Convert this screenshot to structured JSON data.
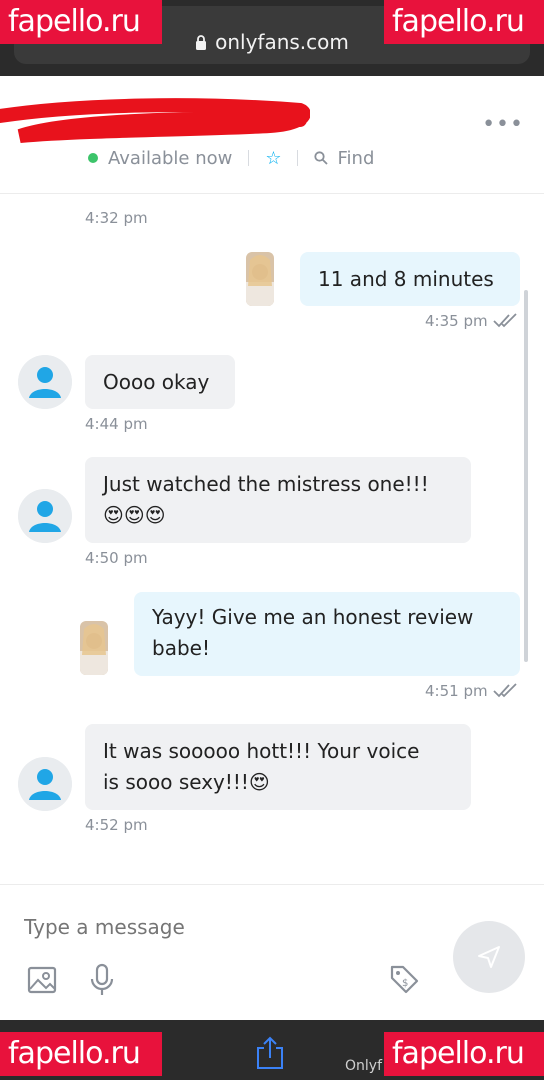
{
  "browser": {
    "url": "onlyfans.com",
    "watermark": "fapello.ru",
    "bottom_text": "Onlyf"
  },
  "header": {
    "status": "Available now",
    "find_label": "Find",
    "more_icon": "more-dots-icon",
    "star_icon": "star-icon",
    "search_icon": "search-icon"
  },
  "messages": {
    "t0": "4:32 pm",
    "m1_text": "11 and 8 minutes",
    "m1_time": "4:35 pm",
    "m2_text": "Oooo okay",
    "m2_time": "4:44 pm",
    "m3_line1": "Just watched the mistress one!!!",
    "m3_line2": "😍😍😍",
    "m3_time": "4:50 pm",
    "m4_line1": "Yayy! Give me an honest review",
    "m4_line2": "babe!",
    "m4_time": "4:51 pm",
    "m5_line1": "It was sooooo hott!!! Your voice",
    "m5_line2": "is sooo sexy!!!😍",
    "m5_time": "4:52 pm"
  },
  "composer": {
    "placeholder": "Type a message",
    "icons": [
      "image-icon",
      "microphone-icon",
      "price-tag-icon",
      "send-icon"
    ]
  },
  "colors": {
    "accent": "#00aff0",
    "online": "#3cc46a",
    "incoming_bubble": "#f0f1f3",
    "outgoing_bubble": "#e7f6fd",
    "watermark": "#e8123c"
  }
}
